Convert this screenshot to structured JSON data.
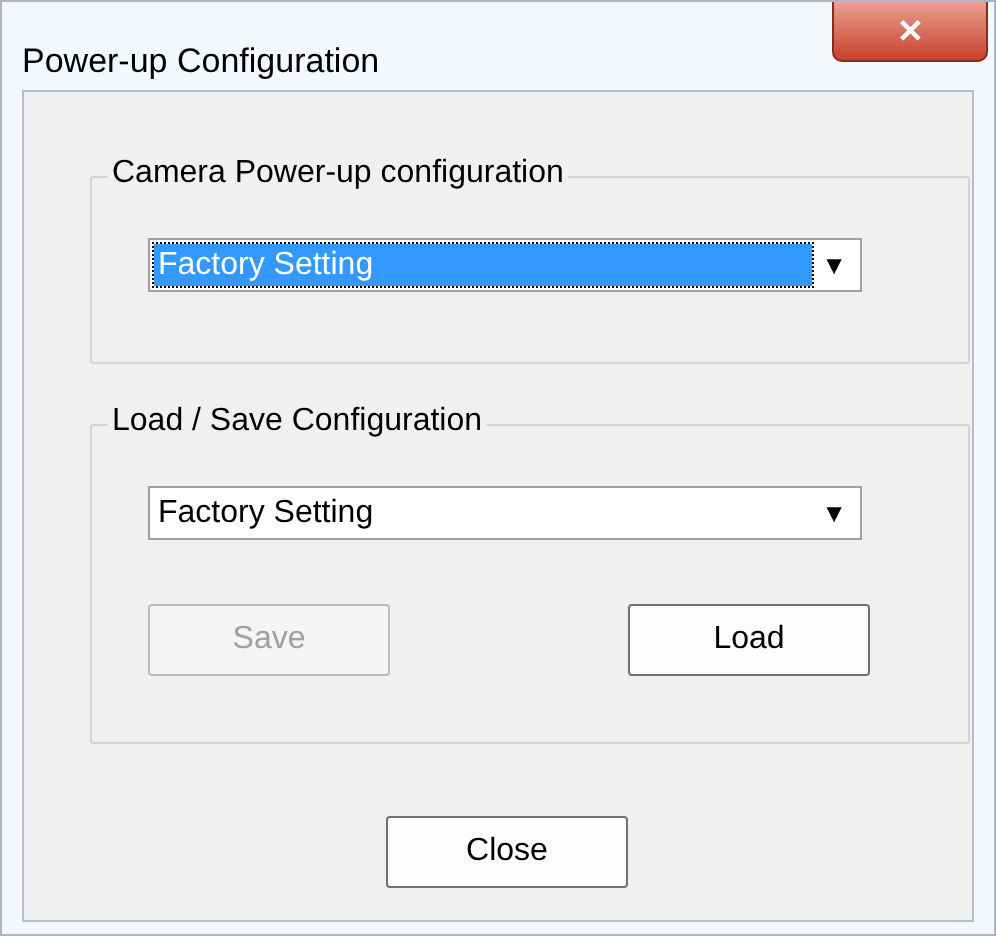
{
  "window": {
    "title": "Power-up Configuration",
    "close_glyph": "✕"
  },
  "groups": [
    {
      "label": "Camera Power-up configuration",
      "dropdown": {
        "value": "Factory Setting",
        "selected": true,
        "arrow": "▼"
      }
    },
    {
      "label": "Load / Save Configuration",
      "dropdown": {
        "value": "Factory Setting",
        "selected": false,
        "arrow": "▼"
      },
      "buttons": [
        {
          "label": "Save",
          "disabled": true
        },
        {
          "label": "Load",
          "disabled": false
        }
      ]
    }
  ],
  "footer_button": {
    "label": "Close",
    "disabled": false
  }
}
